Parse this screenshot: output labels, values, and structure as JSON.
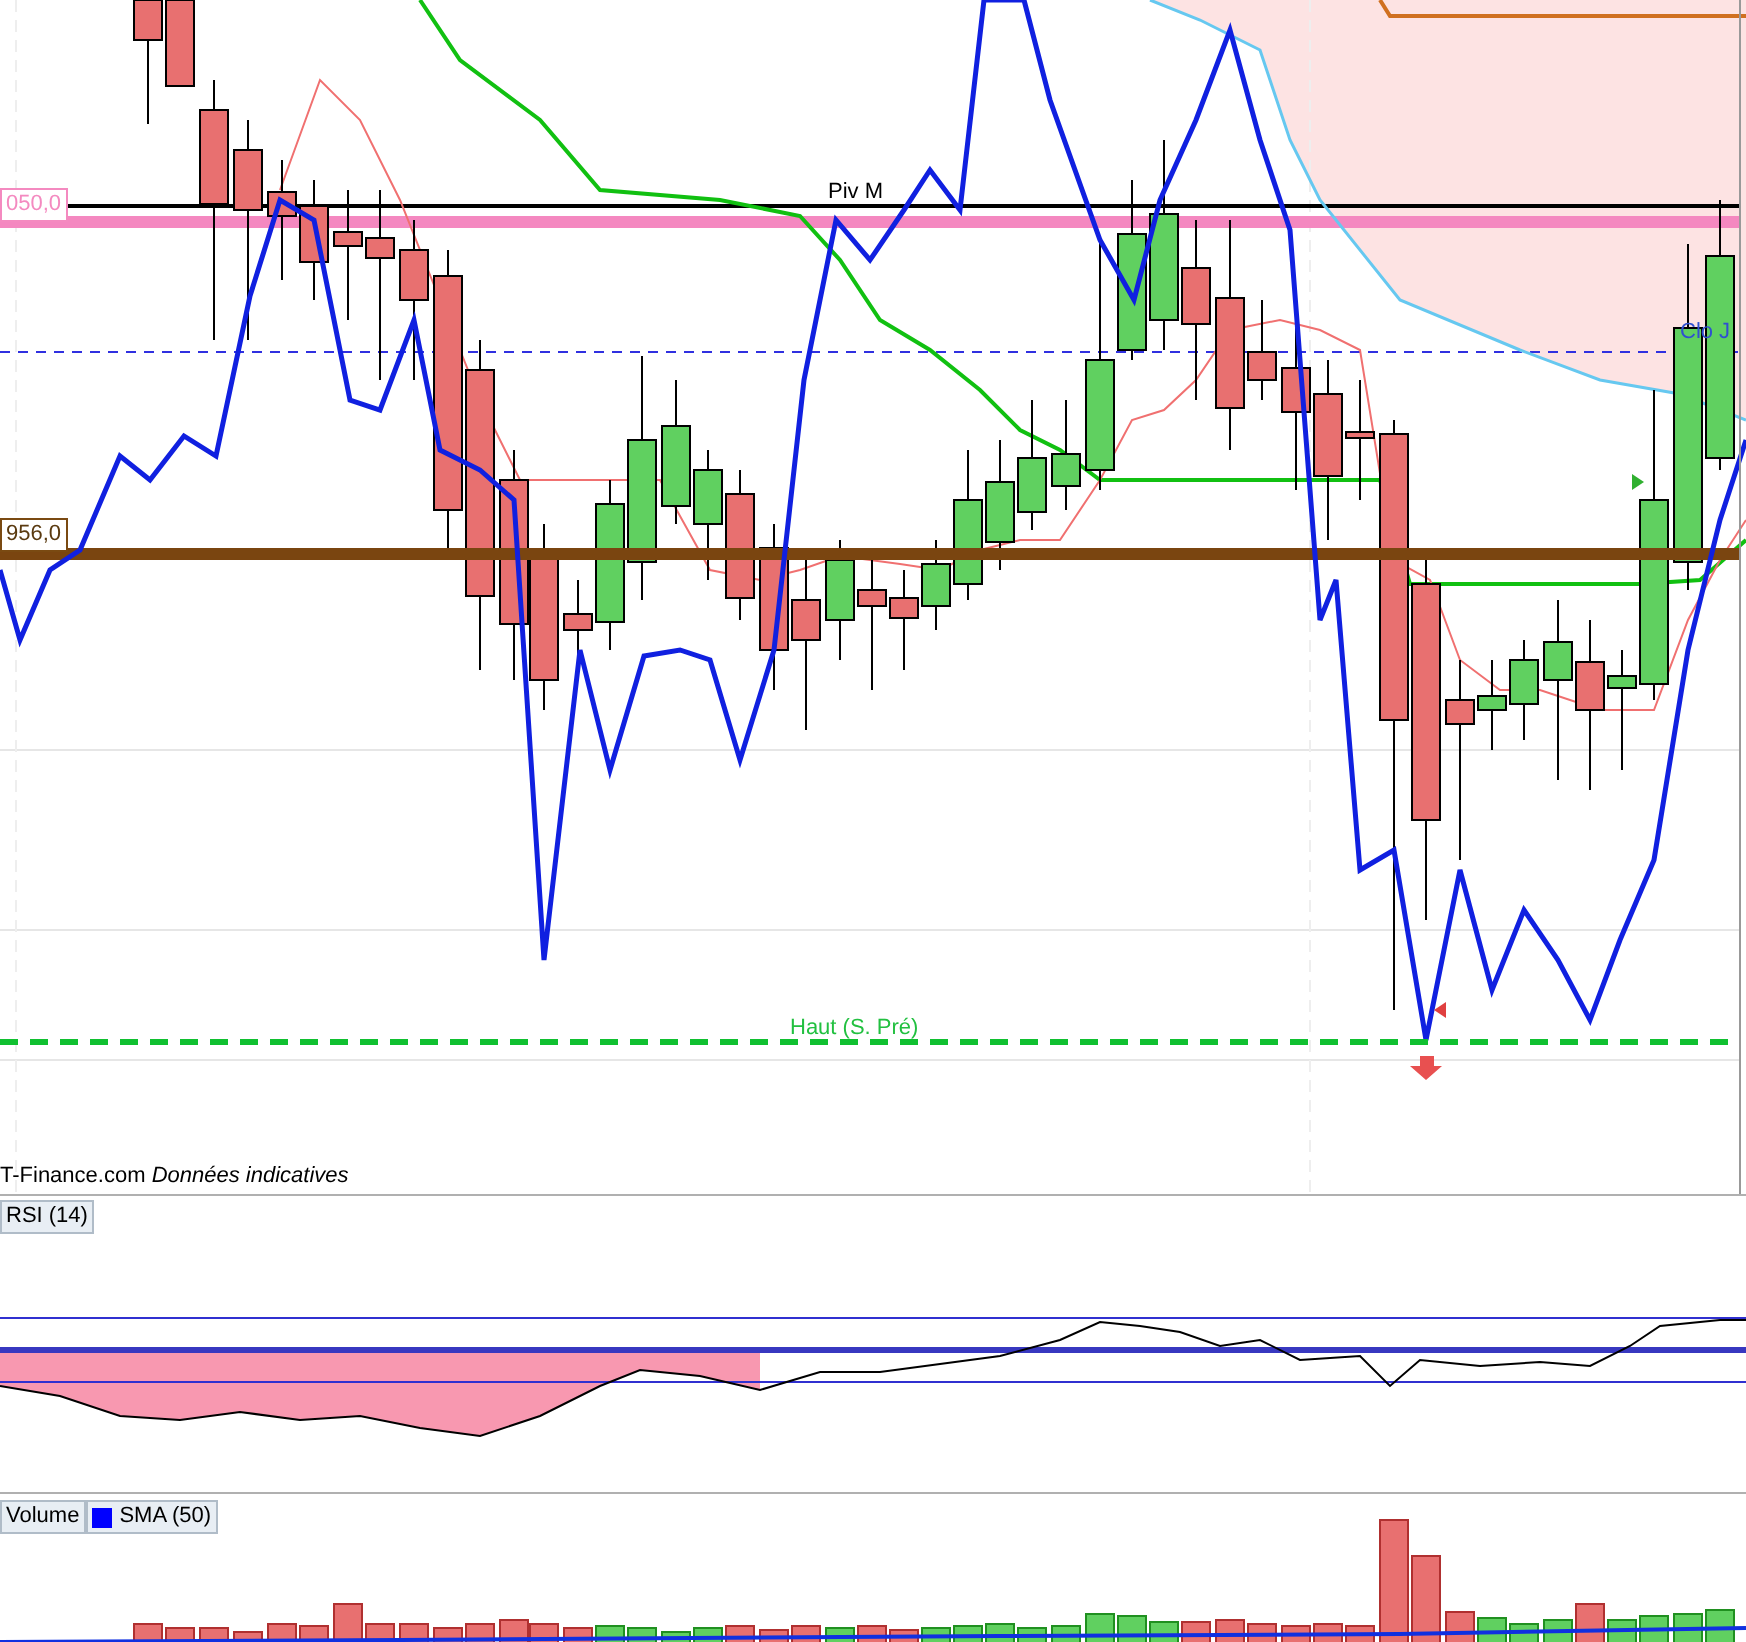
{
  "chart": {
    "price_labels": [
      {
        "text": "050,0",
        "kind": "pivot"
      },
      {
        "text": "956,0",
        "kind": "support"
      }
    ],
    "line_labels": [
      {
        "text": "Piv M",
        "kind": "pivot"
      },
      {
        "text": "Clo J",
        "kind": "close"
      },
      {
        "text": "Haut (S. Pré)",
        "kind": "high"
      }
    ],
    "source_note": "T-Finance.com *Données indicatives*"
  },
  "rsi_pane": {
    "legend": "RSI (14)"
  },
  "volume_pane": {
    "legends": [
      {
        "text": "Volume"
      },
      {
        "text": "SMA (50)",
        "color": "#0000ff"
      }
    ]
  }
}
